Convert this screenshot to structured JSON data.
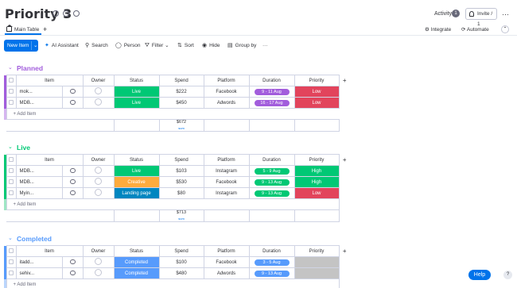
{
  "header": {
    "title": "Priority 3",
    "activity_label": "Activity",
    "activity_count": "1",
    "invite_label": "Invite / 1",
    "more_glyph": "···"
  },
  "tabs": {
    "main_tab": "Main Table",
    "add_tab": "+",
    "integrate": "Integrate",
    "automate": "Automate"
  },
  "toolbar": {
    "new_item": "New Item",
    "ai_assistant": "AI Assistant",
    "search": "Search",
    "person": "Person",
    "filter": "Filter",
    "sort": "Sort",
    "hide": "Hide",
    "group_by": "Group by",
    "more": "···"
  },
  "columns": {
    "item": "Item",
    "owner": "Owner",
    "status": "Status",
    "spend": "Spend",
    "platform": "Platform",
    "duration": "Duration",
    "priority": "Priority",
    "add": "+"
  },
  "colors": {
    "planned": "#a25ddc",
    "live": "#00c875",
    "completed": "#579bfc",
    "status_live": "#00c875",
    "status_creative": "#fdab3d",
    "status_landing": "#0086c0",
    "status_completed": "#579bfc",
    "priority_low": "#e2445c",
    "priority_high": "#00c875",
    "priority_empty": "#c4c4c4",
    "duration_purple": "#a25ddc",
    "duration_green": "#00c875",
    "duration_blue": "#579bfc"
  },
  "groups": [
    {
      "name": "Planned",
      "add_item": "+ Add Item",
      "sum": "$672",
      "sum_label": "sum",
      "rows": [
        {
          "item": "mok...",
          "status": "Live",
          "spend": "$222",
          "platform": "Facebook",
          "duration": "9 - 11 Aug",
          "priority": "Low"
        },
        {
          "item": "MDB...",
          "status": "Live",
          "spend": "$450",
          "platform": "Adwords",
          "duration": "16 - 17 Aug",
          "priority": "Low"
        }
      ]
    },
    {
      "name": "Live",
      "add_item": "+ Add Item",
      "sum": "$713",
      "sum_label": "sum",
      "rows": [
        {
          "item": "MDB...",
          "status": "Live",
          "spend": "$103",
          "platform": "Instagram",
          "duration": "5 - 9 Aug",
          "priority": "High"
        },
        {
          "item": "MDB...",
          "status": "Creative",
          "spend": "$530",
          "platform": "Facebook",
          "duration": "9 - 13 Aug",
          "priority": "High"
        },
        {
          "item": "Myin...",
          "status": "Landing page",
          "spend": "$80",
          "platform": "Instagram",
          "duration": "9 - 13 Aug",
          "priority": "Low"
        }
      ]
    },
    {
      "name": "Completed",
      "add_item": "+ Add Item",
      "rows": [
        {
          "item": "itadd...",
          "status": "Completed",
          "spend": "$100",
          "platform": "Facebook",
          "duration": "3 - 5 Aug",
          "priority": ""
        },
        {
          "item": "sehiv...",
          "status": "Completed",
          "spend": "$480",
          "platform": "Adwords",
          "duration": "9 - 13 Aug",
          "priority": ""
        }
      ]
    }
  ],
  "help": {
    "label": "Help",
    "icon": "?"
  }
}
